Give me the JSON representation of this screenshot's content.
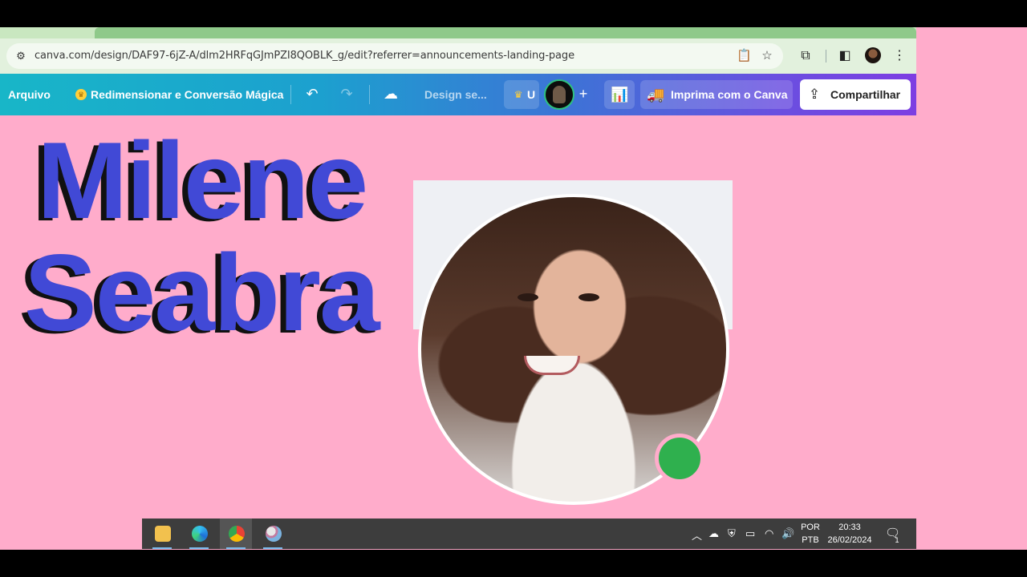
{
  "browser": {
    "url": "canva.com/design/DAF97-6jZ-A/dlm2HRFqGJmPZI8QOBLK_g/edit?referrer=announcements-landing-page"
  },
  "canva_header": {
    "file_menu": "Arquivo",
    "resize_label": "Redimensionar e Conversão Mágica",
    "design_title": "Design se...",
    "upgrade_short": "U",
    "print_label": "Imprima com o Canva",
    "share_label": "Compartilhar"
  },
  "canvas": {
    "first_name": "Milene",
    "last_name": "Seabra",
    "background_color": "#ffaccb",
    "name_color": "#4149d6",
    "status_dot_color": "#2fb04e"
  },
  "taskbar": {
    "apps": [
      "file-explorer",
      "edge",
      "chrome",
      "paint"
    ],
    "lang_top": "POR",
    "lang_bottom": "PTB",
    "time": "20:33",
    "date": "26/02/2024",
    "notification_count": "1"
  }
}
